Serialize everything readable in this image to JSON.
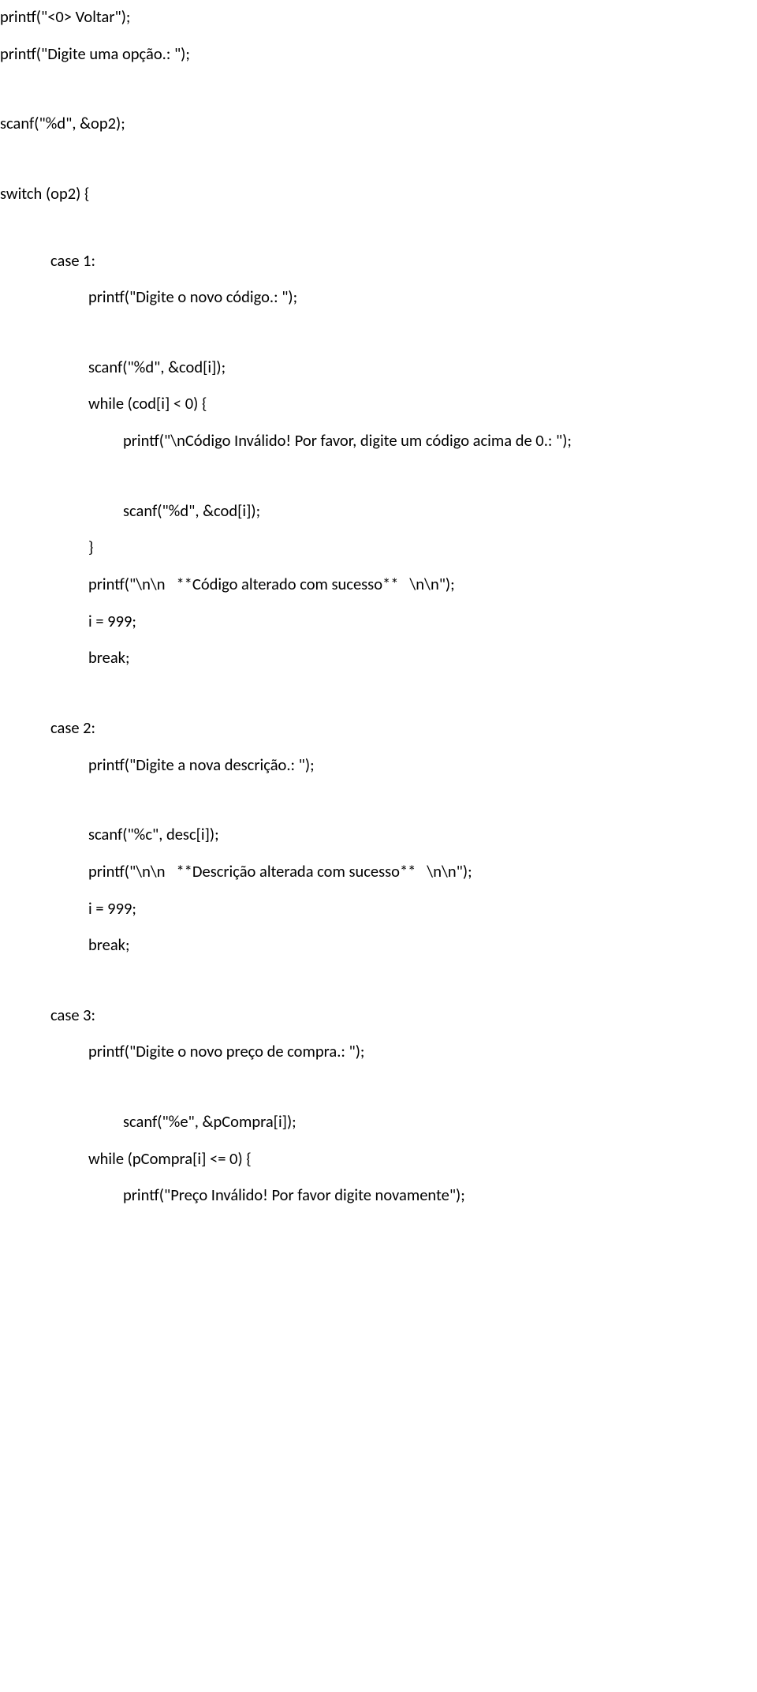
{
  "lines": [
    {
      "text": "printf(\"<0> Voltar\");",
      "indent": "l0"
    },
    {
      "text": "printf(\"Digite uma opção.: \");",
      "indent": "l0",
      "gapAfter": "spacer-med"
    },
    {
      "text": "scanf(\"%d\", &op2);",
      "indent": "l0",
      "gapAfter": "spacer-med"
    },
    {
      "text": "switch (op2) {",
      "indent": "l0",
      "gapAfter": "spacer-xlarge"
    },
    {
      "text": "case 1:",
      "indent": "l1"
    },
    {
      "text": "printf(\"Digite o novo código.: \");",
      "indent": "l2",
      "gapAfter": "spacer-med"
    },
    {
      "text": "scanf(\"%d\", &cod[i]);",
      "indent": "l2"
    },
    {
      "text": "while (cod[i] < 0) {",
      "indent": "l2"
    },
    {
      "text": "printf(\"\\nCódigo Inválido! Por favor, digite um código acima de 0.: \");",
      "indent": "l3",
      "gapAfter": "spacer-med"
    },
    {
      "text": "scanf(\"%d\", &cod[i]);",
      "indent": "l3"
    },
    {
      "text": "}",
      "indent": "l2"
    },
    {
      "text": "printf(\"\\n\\n   **Código alterado com sucesso**   \\n\\n\");",
      "indent": "l2"
    },
    {
      "text": "i = 999;",
      "indent": "l2"
    },
    {
      "text": "break;",
      "indent": "l2",
      "gapAfter": "spacer-large"
    },
    {
      "text": "case 2:",
      "indent": "l1"
    },
    {
      "text": "printf(\"Digite a nova descrição.: \");",
      "indent": "l2",
      "gapAfter": "spacer-med"
    },
    {
      "text": "scanf(\"%c\", desc[i]);",
      "indent": "l2"
    },
    {
      "text": "printf(\"\\n\\n   **Descrição alterada com sucesso**   \\n\\n\");",
      "indent": "l2"
    },
    {
      "text": "i = 999;",
      "indent": "l2"
    },
    {
      "text": "break;",
      "indent": "l2",
      "gapAfter": "spacer-large"
    },
    {
      "text": "case 3:",
      "indent": "l1"
    },
    {
      "text": "printf(\"Digite o novo preço de compra.: \");",
      "indent": "l2",
      "gapAfter": "spacer-med"
    },
    {
      "text": "scanf(\"%e\", &pCompra[i]);",
      "indent": "l3"
    },
    {
      "text": "while (pCompra[i] <= 0) {",
      "indent": "l2"
    },
    {
      "text": "printf(\"Preço Inválido! Por favor digite novamente\");",
      "indent": "l3"
    }
  ]
}
